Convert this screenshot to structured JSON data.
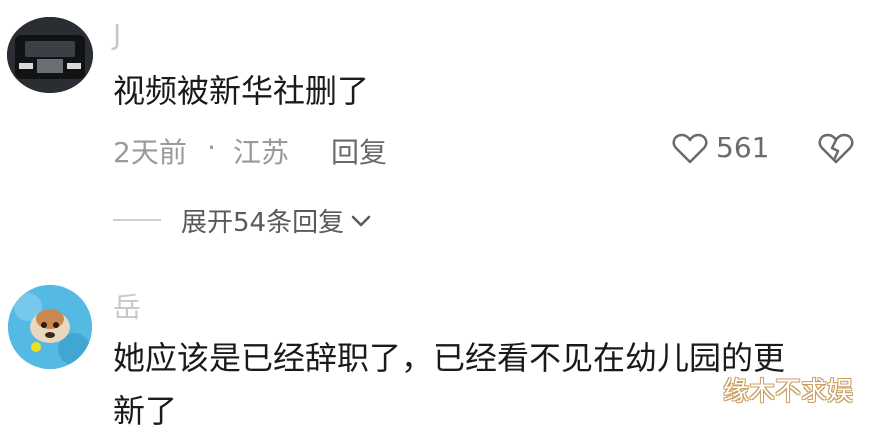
{
  "comments": [
    {
      "username": "J",
      "avatar": "car-avatar",
      "text": "视频被新华社删了",
      "time": "2天前",
      "separator": "·",
      "location": "江苏",
      "reply_label": "回复",
      "likes": "561",
      "expand_label": "展开54条回复"
    },
    {
      "username": "岳",
      "avatar": "dog-avatar",
      "text_line1": "她应该是已经辞职了，已经看不见在幼儿园的更",
      "text_line2": "新了"
    }
  ],
  "watermark": "缘木不求娱",
  "colors": {
    "meta": "#9a9a9a",
    "text": "#1a1a1a",
    "watermark_outline": "#c9a060"
  }
}
